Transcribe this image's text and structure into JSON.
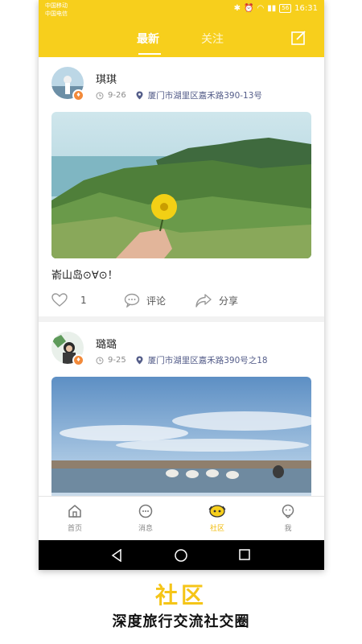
{
  "status_bar": {
    "carrier_1": "中国移动",
    "carrier_2": "中国电信",
    "battery": "56",
    "time": "16:31"
  },
  "header": {
    "tabs": [
      {
        "label": "最新",
        "active": true
      },
      {
        "label": "关注",
        "active": false
      }
    ],
    "edit_icon": "edit-icon"
  },
  "posts": [
    {
      "username": "琪琪",
      "date": "9-26",
      "location": "厦门市湖里区嘉禾路390-13号",
      "caption": "嵛山岛⊙∀⊙！",
      "likes": "1",
      "comment_label": "评论",
      "share_label": "分享"
    },
    {
      "username": "璐璐",
      "date": "9-25",
      "location": "厦门市湖里区嘉禾路390号之18"
    }
  ],
  "bottom_nav": {
    "items": [
      {
        "label": "首页",
        "icon": "home-icon",
        "active": false
      },
      {
        "label": "消息",
        "icon": "message-icon",
        "active": false
      },
      {
        "label": "社区",
        "icon": "community-icon",
        "active": true
      },
      {
        "label": "我",
        "icon": "me-icon",
        "active": false
      }
    ]
  },
  "promo": {
    "title": "社区",
    "subtitle": "深度旅行交流社交圈"
  },
  "colors": {
    "brand": "#f7cf1c",
    "active_nav": "#f0b800",
    "promo_title": "#f5c518"
  }
}
